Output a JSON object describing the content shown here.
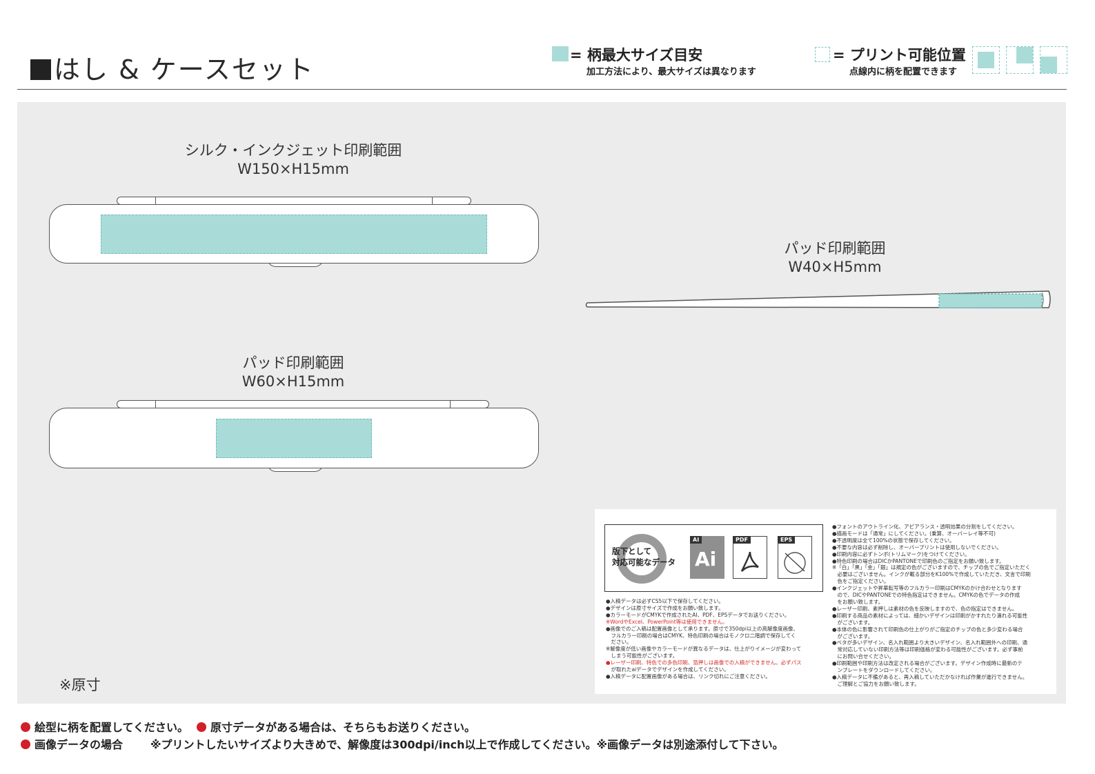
{
  "header": {
    "title": "はし & ケースセット",
    "legend_max_title": "= 柄最大サイズ目安",
    "legend_max_sub": "加工方法により、最大サイズは異なります",
    "legend_pos_title": "= プリント可能位置",
    "legend_pos_sub": "点線内に柄を配置できます"
  },
  "case_silk": {
    "label": "シルク・インクジェット印刷範囲",
    "size": "W150×H15mm"
  },
  "case_pad": {
    "label": "パッド印刷範囲",
    "size": "W60×H15mm"
  },
  "chopstick_pad": {
    "label": "パッド印刷範囲",
    "size": "W40×H5mm"
  },
  "scale_note": "※原寸",
  "data_note": {
    "format_label_1": "版下として",
    "format_label_2": "対応可能なデータ",
    "formats": [
      "AI",
      "PDF",
      "EPS"
    ],
    "ai_glyph": "Ai",
    "left_lines": [
      {
        "text": "●入稿データは必ずCS5以下で保存してください。",
        "red": false
      },
      {
        "text": "●デザインは原寸サイズで作成をお願い致します。",
        "red": false
      },
      {
        "text": "●カラーモードがCMYKで作成されたAI、PDF、EPSデータでお送りください。",
        "red": false
      },
      {
        "text": "※WordやExcel、PowerPoint等は使用できません。",
        "red": true
      },
      {
        "text": "●画像でのご入稿は配置画像として承ります。原寸で350dpi以上の高解像度画像、",
        "red": false
      },
      {
        "text": "　フルカラー印刷の場合はCMYK、特色印刷の場合はモノクロ二階調で保存してく",
        "red": false
      },
      {
        "text": "　ださい。",
        "red": false
      },
      {
        "text": "※解像度が低い画像やカラーモードが異なるデータは、仕上がりイメージが変わって",
        "red": false
      },
      {
        "text": "　しまう可能性がございます。",
        "red": false
      },
      {
        "text": "●レーザー印刷、特色での多色印刷、箔押しは画像での入稿ができません。必ずパス",
        "red": true
      },
      {
        "text": "　が取れたaiデータでデザインを作成してください。",
        "red": false
      },
      {
        "text": "●入稿データに配置画像がある場合は、リンク切れにご注意ください。",
        "red": false
      }
    ],
    "right_lines": [
      "●フォントのアウトライン化、アピアランス・透明効果の分割をしてください。",
      "●描画モードは「通常」にしてください。(乗算、オーバーレイ等不可)",
      "●不透明度は全て100%の状態で保存してください。",
      "●不要な内容は必ず削除し、オーバープリントは使用しないでください。",
      "●印刷内容に必ずトンボ(トリムマーク)をつけてください。",
      "●特色印刷の場合はDICかPANTONEで印刷色のご指定をお願い致します。",
      "※「白」「黒」「金」「銀」は規定の色がございますので、チップの色でご指定いただく",
      "　必要はございません。インクが載る部分をK100%で作成していただき、文言で印刷",
      "　色をご指定ください。",
      "●インクジェットや昇華転写等のフルカラー印刷はCMYKのかけ合わせとなります",
      "　ので、DICやPANTONEでの特色指定はできません。CMYKの色でデータの作成",
      "　をお願い致します。",
      "●レーザー印刷、素押しは素材の色を反映しますので、色の指定はできません。",
      "●印刷する商品の素材によっては、細かいデザインは印刷がかすれたり潰れる可能性",
      "　がございます。",
      "●本体の色に影響されて印刷色の仕上がりがご指定のチップの色と多少変わる場合",
      "　がございます。",
      "●ベタが多いデザイン、名入れ範囲より大きいデザイン、名入れ範囲外への印刷、通",
      "　常対応していない印刷方法等は印刷価格が変わる可能性がございます。必ず事前",
      "　にお問い合せください。",
      "●印刷範囲や印刷方法は改定される場合がございます。デザイン作成時に最新のテ",
      "　ンプレートをダウンロードしてください。",
      "●入稿データに不備があると、再入稿していただかなければ作業が進行できません。",
      "　ご理解とご協力をお願い致します。"
    ]
  },
  "footer": {
    "note1": "絵型に柄を配置してください。",
    "note2": "原寸データがある場合は、そちらもお送りください。",
    "note3_label": "画像データの場合",
    "note3_text": "※プリントしたいサイズより大きめで、解像度は300dpi/inch以上で作成してください。※画像データは別途添付して下さい。"
  },
  "colors": {
    "print_area": "#a9dcd9",
    "print_border": "#6dbdb7",
    "bullet": "#d0202a",
    "panel": "#ececec"
  }
}
